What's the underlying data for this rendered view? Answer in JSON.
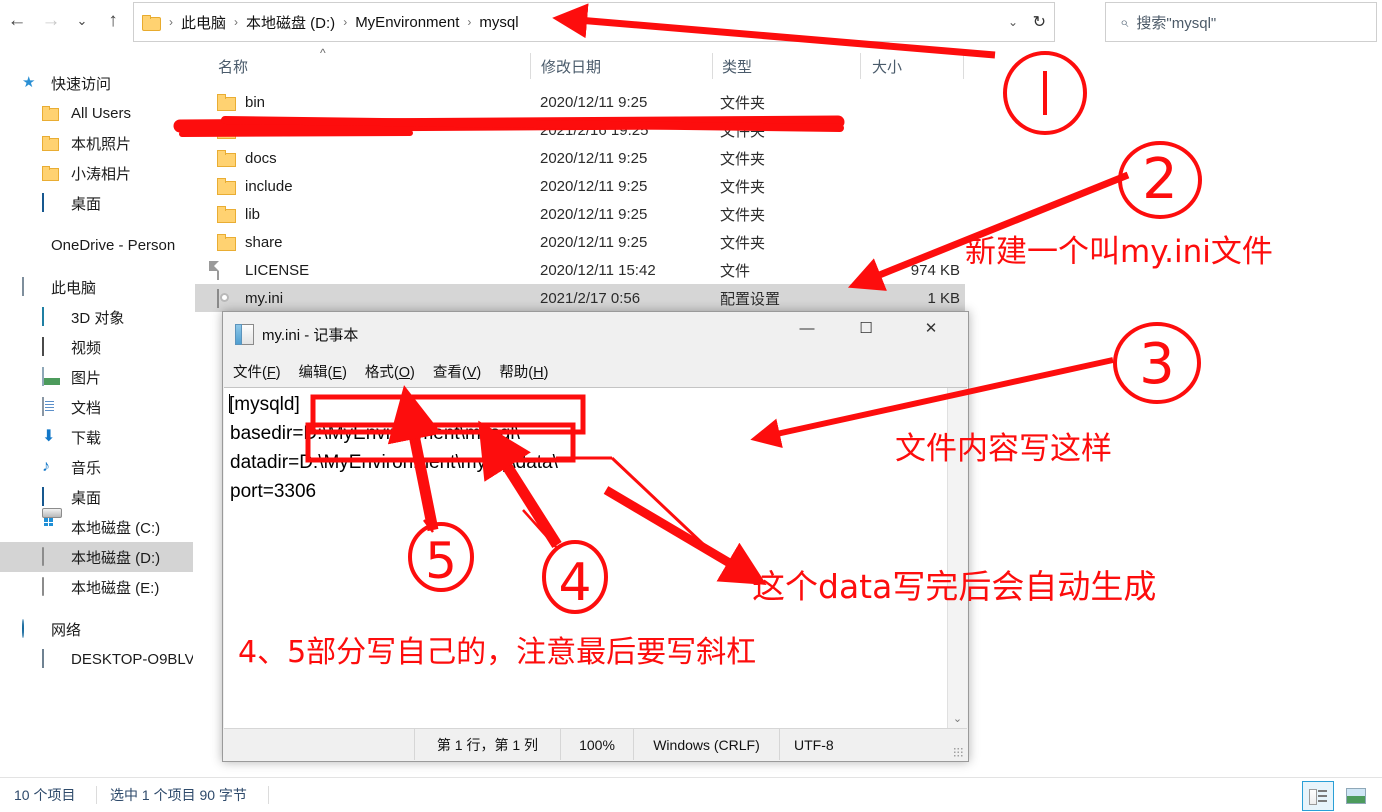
{
  "explorer": {
    "nav": {
      "back_icon": "arrow-left-icon",
      "forward_icon": "arrow-right-icon",
      "recent_icon": "chevron-down-icon",
      "up_icon": "arrow-up-icon"
    },
    "address": {
      "crumbs": [
        "此电脑",
        "本地磁盘 (D:)",
        "MyEnvironment",
        "mysql"
      ],
      "separator": "›",
      "dropdown_icon": "chevron-down-icon",
      "refresh_icon": "refresh-icon"
    },
    "search": {
      "placeholder": "搜索\"mysql\"",
      "icon": "search-icon"
    },
    "columns": [
      {
        "key": "name",
        "label": "名称"
      },
      {
        "key": "date",
        "label": "修改日期"
      },
      {
        "key": "type",
        "label": "类型"
      },
      {
        "key": "size",
        "label": "大小"
      }
    ],
    "sort_indicator": "^",
    "files": [
      {
        "icon": "folder-icon",
        "name": "bin",
        "date": "2020/12/11 9:25",
        "type": "文件夹",
        "size": "",
        "selected": false,
        "redacted": false
      },
      {
        "icon": "folder-icon",
        "name": "",
        "date": "2021/2/16 19:25",
        "type": "文件夹",
        "size": "",
        "selected": false,
        "redacted": true
      },
      {
        "icon": "folder-icon",
        "name": "docs",
        "date": "2020/12/11 9:25",
        "type": "文件夹",
        "size": "",
        "selected": false,
        "redacted": false
      },
      {
        "icon": "folder-icon",
        "name": "include",
        "date": "2020/12/11 9:25",
        "type": "文件夹",
        "size": "",
        "selected": false,
        "redacted": false
      },
      {
        "icon": "folder-icon",
        "name": "lib",
        "date": "2020/12/11 9:25",
        "type": "文件夹",
        "size": "",
        "selected": false,
        "redacted": false
      },
      {
        "icon": "folder-icon",
        "name": "share",
        "date": "2020/12/11 9:25",
        "type": "文件夹",
        "size": "",
        "selected": false,
        "redacted": false
      },
      {
        "icon": "file-icon",
        "name": "LICENSE",
        "date": "2020/12/11 15:42",
        "type": "文件",
        "size": "974 KB",
        "selected": false,
        "redacted": false
      },
      {
        "icon": "ini-icon",
        "name": "my.ini",
        "date": "2021/2/17 0:56",
        "type": "配置设置",
        "size": "1 KB",
        "selected": true,
        "redacted": false
      }
    ],
    "sidebar": [
      {
        "icon": "star-icon",
        "label": "快速访问",
        "indent": 0,
        "selected": false,
        "gap_before": false
      },
      {
        "icon": "folder-icon",
        "label": "All Users",
        "indent": 1,
        "selected": false,
        "gap_before": false
      },
      {
        "icon": "folder-icon",
        "label": "本机照片",
        "indent": 1,
        "selected": false,
        "gap_before": false
      },
      {
        "icon": "folder-icon",
        "label": "小涛相片",
        "indent": 1,
        "selected": false,
        "gap_before": false
      },
      {
        "icon": "desktop-icon",
        "label": "桌面",
        "indent": 1,
        "selected": false,
        "gap_before": false
      },
      {
        "icon": "cloud-icon",
        "label": "OneDrive - Person",
        "indent": 0,
        "selected": false,
        "gap_before": true
      },
      {
        "icon": "this-pc-icon",
        "label": "此电脑",
        "indent": 0,
        "selected": false,
        "gap_before": true
      },
      {
        "icon": "cube-3d-icon",
        "label": "3D 对象",
        "indent": 1,
        "selected": false,
        "gap_before": false
      },
      {
        "icon": "video-icon",
        "label": "视频",
        "indent": 1,
        "selected": false,
        "gap_before": false
      },
      {
        "icon": "picture-icon",
        "label": "图片",
        "indent": 1,
        "selected": false,
        "gap_before": false
      },
      {
        "icon": "document-icon",
        "label": "文档",
        "indent": 1,
        "selected": false,
        "gap_before": false
      },
      {
        "icon": "download-icon",
        "label": "下载",
        "indent": 1,
        "selected": false,
        "gap_before": false
      },
      {
        "icon": "music-icon",
        "label": "音乐",
        "indent": 1,
        "selected": false,
        "gap_before": false
      },
      {
        "icon": "desktop-icon",
        "label": "桌面",
        "indent": 1,
        "selected": false,
        "gap_before": false
      },
      {
        "icon": "windows-drive-icon",
        "label": "本地磁盘 (C:)",
        "indent": 1,
        "selected": false,
        "gap_before": false
      },
      {
        "icon": "drive-icon",
        "label": "本地磁盘 (D:)",
        "indent": 1,
        "selected": true,
        "gap_before": false
      },
      {
        "icon": "drive-icon",
        "label": "本地磁盘 (E:)",
        "indent": 1,
        "selected": false,
        "gap_before": false
      },
      {
        "icon": "network-icon",
        "label": "网络",
        "indent": 0,
        "selected": false,
        "gap_before": true
      },
      {
        "icon": "monitor-icon",
        "label": "DESKTOP-O9BLV",
        "indent": 1,
        "selected": false,
        "gap_before": false
      }
    ],
    "status": {
      "item_count": "10 个项目",
      "selection": "选中 1 个项目  90 字节",
      "view_details_icon": "details-view-icon",
      "view_thumbnails_icon": "thumbnails-view-icon"
    }
  },
  "notepad": {
    "title": "my.ini - 记事本",
    "app_icon": "notepad-icon",
    "window_buttons": {
      "minimize": "—",
      "maximize": "☐",
      "close": "✕"
    },
    "menus": [
      {
        "text": "文件(F)",
        "pre": "文件(",
        "key": "F",
        "post": ")"
      },
      {
        "text": "编辑(E)",
        "pre": "编辑(",
        "key": "E",
        "post": ")"
      },
      {
        "text": "格式(O)",
        "pre": "格式(",
        "key": "O",
        "post": ")"
      },
      {
        "text": "查看(V)",
        "pre": "查看(",
        "key": "V",
        "post": ")"
      },
      {
        "text": "帮助(H)",
        "pre": "帮助(",
        "key": "H",
        "post": ")"
      }
    ],
    "content_lines": [
      "[mysqld]",
      "basedir=D:\\MyEnvironment\\mysql\\",
      "datadir=D:\\MyEnvironment\\mysql\\data\\",
      "port=3306"
    ],
    "scroll_up_icon": "chevron-up-icon",
    "scroll_down_icon": "chevron-down-icon",
    "status": {
      "cursor": "第 1 行，第 1 列",
      "zoom": "100%",
      "line_ending": "Windows (CRLF)",
      "encoding": "UTF-8"
    }
  },
  "annotations": {
    "color": "#fd0d0d",
    "markers": [
      {
        "id": "1",
        "label": "①"
      },
      {
        "id": "2",
        "label": "②"
      },
      {
        "id": "3",
        "label": "③"
      },
      {
        "id": "4",
        "label": "④"
      },
      {
        "id": "5",
        "label": "⑤"
      }
    ],
    "notes": [
      {
        "id": "note-2",
        "text": "新建一个叫my.ini文件"
      },
      {
        "id": "note-3",
        "text": "文件内容写这样"
      },
      {
        "id": "note-data",
        "text": "这个data写完后会自动生成"
      },
      {
        "id": "note-bottom",
        "text": "4、5部分写自己的，注意最后要写斜杠"
      }
    ]
  }
}
